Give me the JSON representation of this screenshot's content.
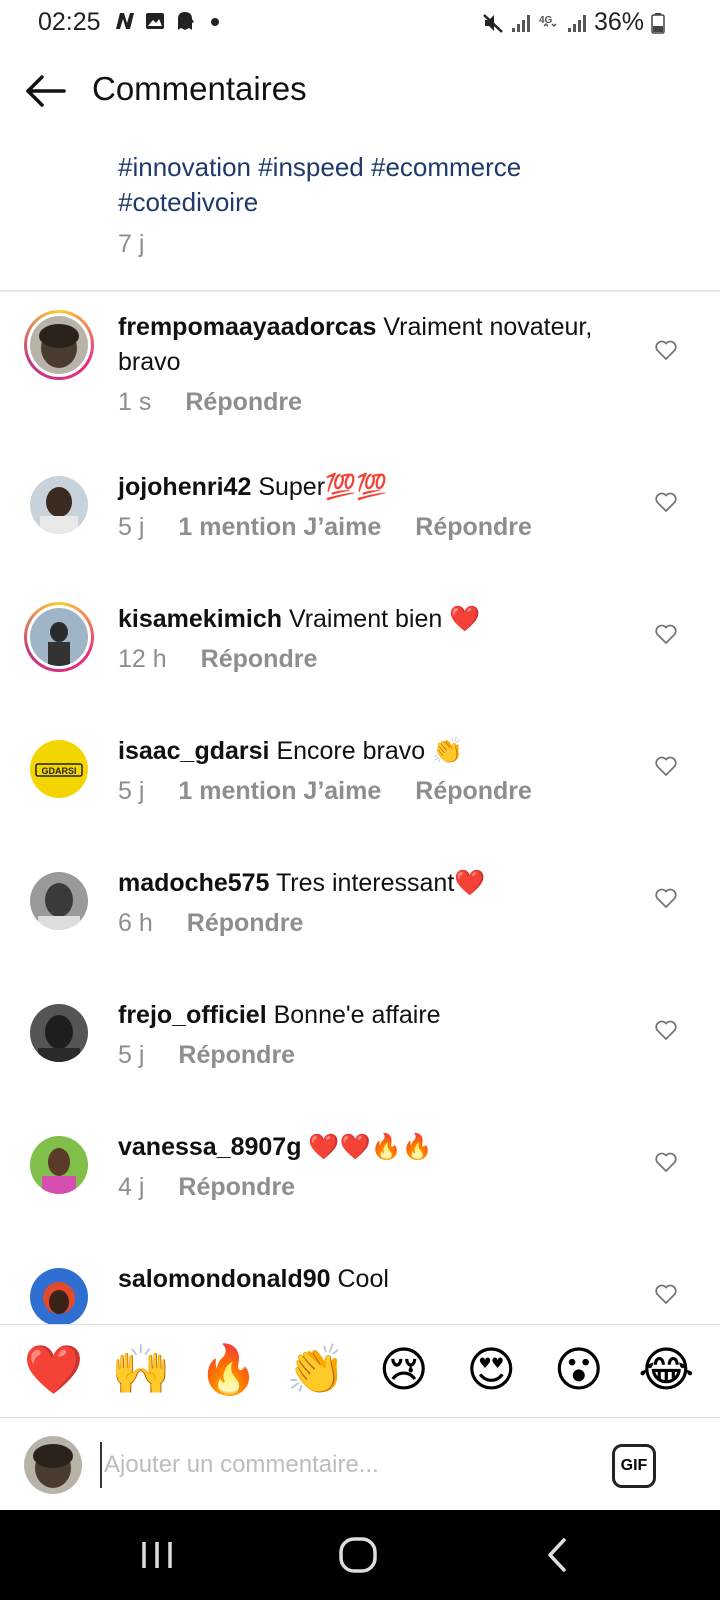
{
  "status_bar": {
    "time": "02:25",
    "battery": "36%",
    "left_icons": [
      "n-app-icon",
      "gallery-icon",
      "ghost-icon",
      "dot-icon"
    ],
    "right_icons": [
      "mute-icon",
      "signal-icon",
      "4g-icon",
      "signal-icon",
      "battery-icon"
    ]
  },
  "header": {
    "title": "Commentaires"
  },
  "caption": {
    "line1": "#innovation #inspeed #ecommerce",
    "line2": "#cotedivoire",
    "age": "7 j"
  },
  "comments": [
    {
      "username": "frempomaayaadorcas",
      "text": " Vraiment novateur, bravo",
      "age": "1 s",
      "likes": "",
      "reply": "Répondre",
      "story_ring": true,
      "avatar_color": "#4a3b2e"
    },
    {
      "username": "jojohenri42",
      "text": " Super💯💯",
      "age": "5 j",
      "likes": "1 mention J’aime",
      "reply": "Répondre",
      "story_ring": false,
      "avatar_color": "#6b7d8c"
    },
    {
      "username": "kisamekimich",
      "text": " Vraiment bien ❤️",
      "age": "12 h",
      "likes": "",
      "reply": "Répondre",
      "story_ring": true,
      "avatar_color": "#8a9aa8"
    },
    {
      "username": "isaac_gdarsi",
      "text": " Encore bravo 👏",
      "age": "5 j",
      "likes": "1 mention J’aime",
      "reply": "Répondre",
      "story_ring": false,
      "avatar_color": "#f3d500",
      "avatar_text": "GDARSI"
    },
    {
      "username": "madoche575",
      "text": " Tres interessant❤️",
      "age": "6 h",
      "likes": "",
      "reply": "Répondre",
      "story_ring": false,
      "avatar_color": "#7a7a7a"
    },
    {
      "username": "frejo_officiel",
      "text": " Bonne'e affaire",
      "age": "5 j",
      "likes": "",
      "reply": "Répondre",
      "story_ring": false,
      "avatar_color": "#3c3c3c"
    },
    {
      "username": "vanessa_8907g",
      "text": " ❤️❤️🔥🔥",
      "age": "4 j",
      "likes": "",
      "reply": "Répondre",
      "story_ring": false,
      "avatar_color": "#6fae3a"
    },
    {
      "username": "salomondonald90",
      "text": " Cool",
      "age": "",
      "likes": "",
      "reply": "",
      "story_ring": false,
      "avatar_color": "#1f4fa8"
    }
  ],
  "emoji_bar": [
    "❤️",
    "🙌",
    "🔥",
    "👏",
    "😢",
    "😍",
    "😮",
    "😂"
  ],
  "input_bar": {
    "placeholder": "Ajouter un commentaire...",
    "gif_label": "GIF"
  },
  "nav_bar": [
    "recents-icon",
    "home-icon",
    "back-nav-icon"
  ]
}
